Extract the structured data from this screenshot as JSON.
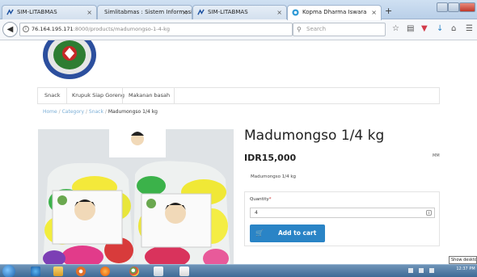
{
  "browser": {
    "tabs": [
      {
        "label": "SIM-LITABMAS"
      },
      {
        "label": "Simlitabmas : Sistem Informasi..."
      },
      {
        "label": "SIM-LITABMAS"
      },
      {
        "label": "Kopma Dharma Iswara"
      }
    ],
    "new_tab": "+",
    "url_host": "76.164.195.171",
    "url_path": ":8000/products/madumongso-1-4-kg",
    "search_placeholder": "Search",
    "icons": [
      "back-icon",
      "info-icon",
      "reload-icon",
      "search-icon",
      "star-icon",
      "reader-icon",
      "pocket-icon",
      "download-icon",
      "home-icon",
      "menu-icon"
    ]
  },
  "site": {
    "categories": [
      "Snack",
      "Krupuk Siap Goreng",
      "Makanan basah"
    ]
  },
  "breadcrumb": {
    "home": "Home",
    "category": "Category",
    "sub": "Snack",
    "current": "Madumongso 1/4 kg",
    "separator": "/"
  },
  "product": {
    "title": "Madumongso 1/4 kg",
    "price": "IDR15,000",
    "mm": "MM",
    "description": "Madumongso 1/4 kg",
    "quantity_label": "Quantity",
    "quantity_required": "*",
    "quantity": "4",
    "add_to_cart": "Add to cart"
  },
  "tooltip": "Show desktop",
  "taskbar": {
    "time": "12:37 PM"
  },
  "colors": {
    "accent": "#2a84c6",
    "breadcrumb_link": "#7aaed6"
  }
}
